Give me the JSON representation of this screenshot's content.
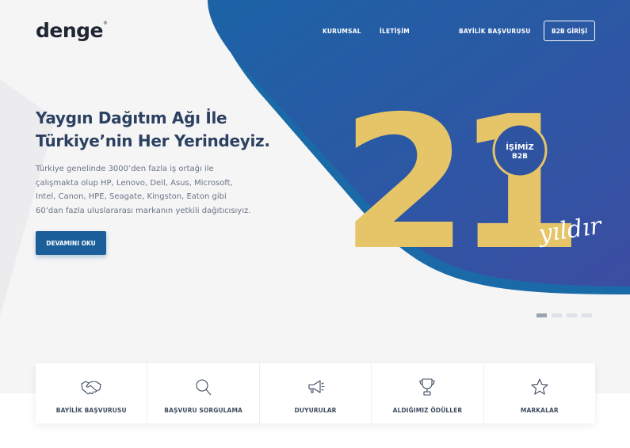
{
  "header": {
    "logo": "denge",
    "logo_mark": "®",
    "nav": {
      "kurumsal": "KURUMSAL",
      "iletisim": "İLETİŞİM",
      "bayilik": "BAYİLİK BAŞVURUSU",
      "b2b": "B2B GİRİŞİ"
    }
  },
  "hero": {
    "headline_line1": "Yaygın Dağıtım Ağı İle",
    "headline_line2": "Türkiye’nin Her Yerindeyiz.",
    "description": "Türkiye genelinde 3000’den fazla iş ortağı ile çalışmakta olup HP, Lenovo, Dell, Asus, Microsoft, Intel, Canon, HPE, Seagate, Kingston, Eaton gibi 60’dan fazla uluslararası markanın yetkili dağıtıcısıyız.",
    "cta": "DEVAMINI OKU",
    "anniversary_number": "21",
    "badge_line1": "İŞİMİZ",
    "badge_line2": "B2B",
    "script_word": "yıldır"
  },
  "slider": {
    "total": 4,
    "active": 1
  },
  "cards": [
    {
      "label": "BAYİLİK BAŞVURUSU",
      "icon": "handshake-icon"
    },
    {
      "label": "BAŞVURU SORGULAMA",
      "icon": "search-icon"
    },
    {
      "label": "DUYURULAR",
      "icon": "megaphone-icon"
    },
    {
      "label": "ALDIĞIMIZ ÖDÜLLER",
      "icon": "trophy-icon"
    },
    {
      "label": "MARKALAR",
      "icon": "star-icon"
    }
  ],
  "colors": {
    "blue_dark": "#1b5f9a",
    "blue_light": "#3a4fa3",
    "gold": "#e6c468",
    "background": "#f5f5f6"
  }
}
